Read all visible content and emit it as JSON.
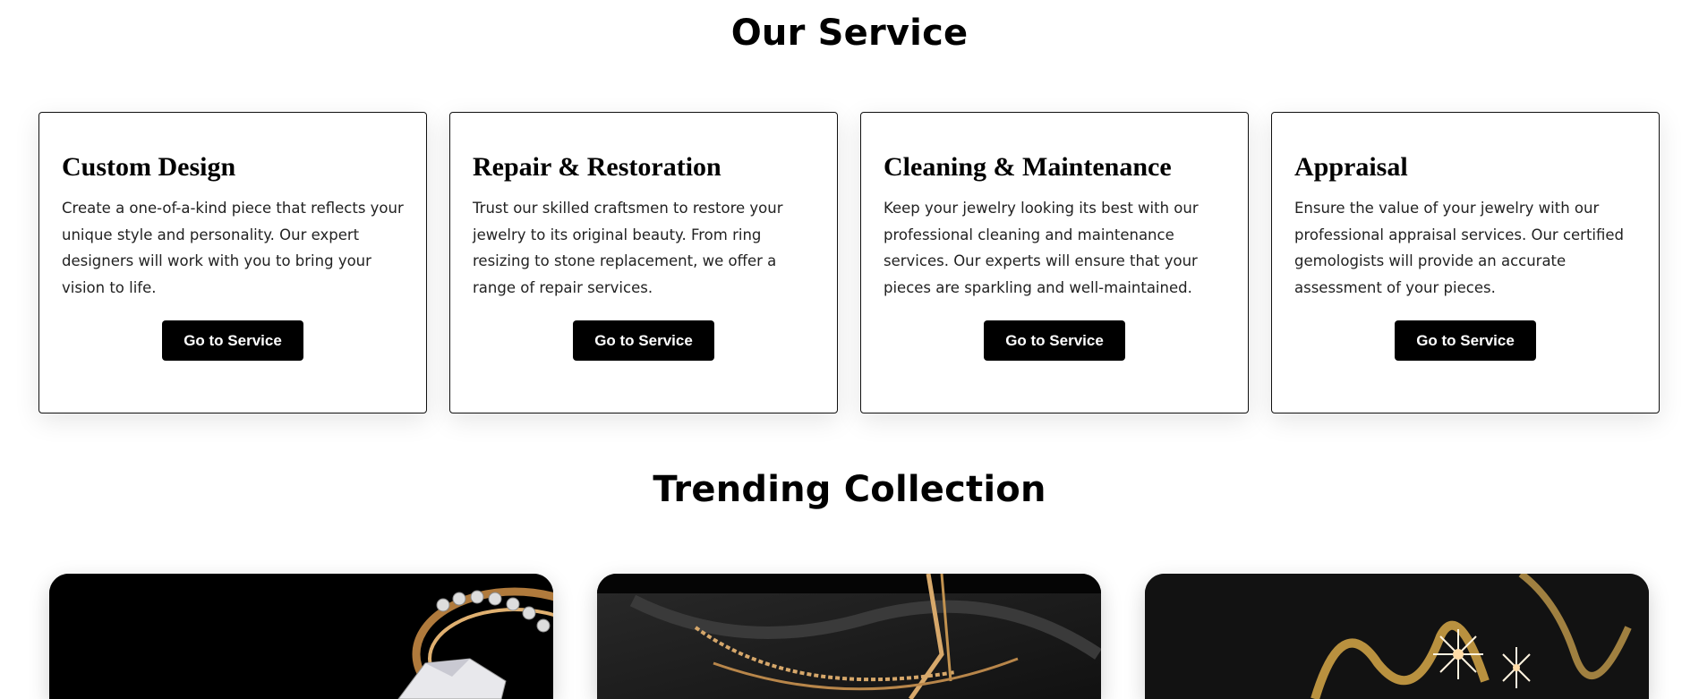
{
  "service_section": {
    "title": "Our Service"
  },
  "services": [
    {
      "title": "Custom Design",
      "description": "Create a one-of-a-kind piece that reflects your unique style and personality. Our expert designers will work with you to bring your vision to life.",
      "button_label": "Go to Service"
    },
    {
      "title": "Repair & Restoration",
      "description": "Trust our skilled craftsmen to restore your jewelry to its original beauty. From ring resizing to stone replacement, we offer a range of repair services.",
      "button_label": "Go to Service"
    },
    {
      "title": "Cleaning & Maintenance",
      "description": "Keep your jewelry looking its best with our professional cleaning and maintenance services. Our experts will ensure that your pieces are sparkling and well-maintained.",
      "button_label": "Go to Service"
    },
    {
      "title": "Appraisal",
      "description": "Ensure the value of your jewelry with our professional appraisal services. Our certified gemologists will provide an accurate assessment of your pieces.",
      "button_label": "Go to Service"
    }
  ],
  "trending_section": {
    "title": "Trending Collection"
  },
  "colors": {
    "background": "#ffffff",
    "text": "#000000",
    "button_bg": "#000000",
    "button_text": "#ffffff",
    "gold": "#c89a5a"
  }
}
